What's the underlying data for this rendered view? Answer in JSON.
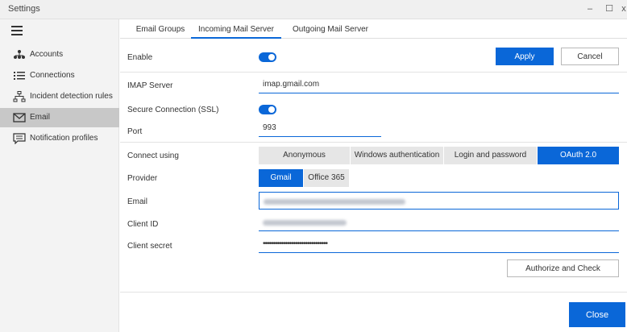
{
  "window": {
    "title": "Settings",
    "minimize": "–",
    "maximize": "☐",
    "close": "x"
  },
  "sidebar": {
    "items": [
      {
        "label": "Accounts",
        "icon": "accounts-tree-icon"
      },
      {
        "label": "Connections",
        "icon": "list-icon"
      },
      {
        "label": "Incident detection rules",
        "icon": "rules-icon"
      },
      {
        "label": "Email",
        "icon": "envelope-icon",
        "active": true
      },
      {
        "label": "Notification profiles",
        "icon": "message-icon"
      }
    ]
  },
  "tabs": [
    {
      "label": "Email Groups"
    },
    {
      "label": "Incoming Mail Server",
      "active": true
    },
    {
      "label": "Outgoing Mail Server"
    }
  ],
  "form": {
    "enable_label": "Enable",
    "apply": "Apply",
    "cancel": "Cancel",
    "imap_label": "IMAP Server",
    "imap_value": "imap.gmail.com",
    "ssl_label": "Secure Connection (SSL)",
    "port_label": "Port",
    "port_value": "993",
    "connect_label": "Connect using",
    "connect_options": [
      "Anonymous",
      "Windows authentication",
      "Login and password",
      "OAuth 2.0"
    ],
    "connect_selected": "OAuth 2.0",
    "provider_label": "Provider",
    "provider_options": [
      "Gmail",
      "Office 365"
    ],
    "provider_selected": "Gmail",
    "email_label": "Email",
    "client_id_label": "Client ID",
    "client_secret_label": "Client secret",
    "client_secret_value": "••••••••••••••••••••••••••••••••",
    "authorize": "Authorize and Check"
  },
  "footer": {
    "close": "Close"
  },
  "colors": {
    "accent": "#0a67d8",
    "sidebar_bg": "#f3f3f3",
    "active_item_bg": "#c8c8c8"
  }
}
